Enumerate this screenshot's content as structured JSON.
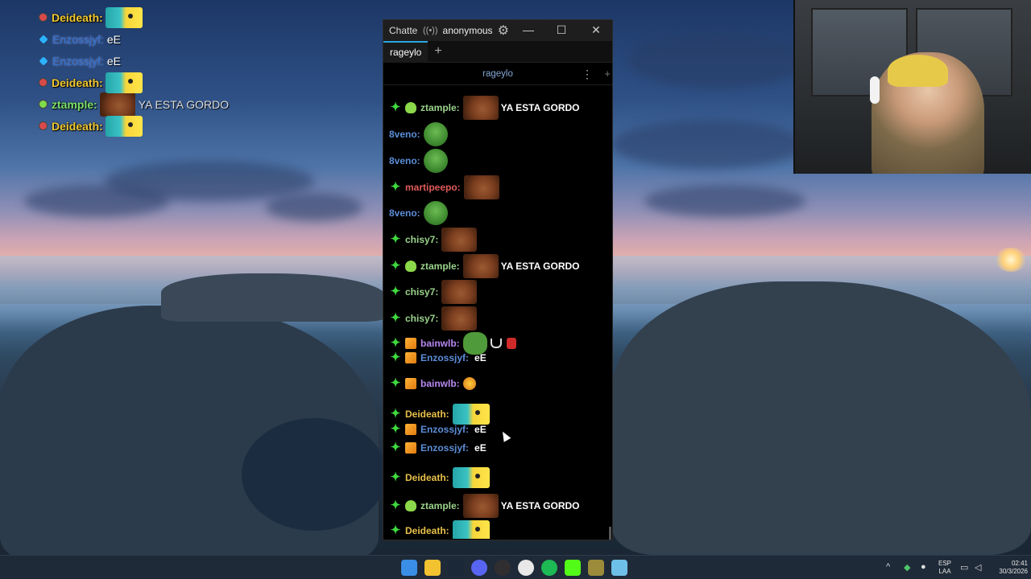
{
  "overlay_chat": [
    {
      "name": "Deideath:",
      "message": "",
      "badge": "mod",
      "emote": "pikachu"
    },
    {
      "name": "Enzossjyf:",
      "message": "eE",
      "badge": "diamond",
      "emote": ""
    },
    {
      "name": "Enzossjyf:",
      "message": "eE",
      "badge": "diamond",
      "emote": ""
    },
    {
      "name": "Deideath:",
      "message": "",
      "badge": "mod",
      "emote": "pikachu"
    },
    {
      "name": "ztample:",
      "message": "YA ESTA GORDO",
      "badge": "alien",
      "emote": "dog"
    },
    {
      "name": "Deideath:",
      "message": "",
      "badge": "mod",
      "emote": "pikachu"
    }
  ],
  "window": {
    "app_name": "Chatterino",
    "stream_icon": "broadcast-icon",
    "user": "anonymous",
    "minimize": "—",
    "maximize": "☐",
    "close": "✕"
  },
  "tabs": [
    {
      "label": "rageylo"
    }
  ],
  "tab_add": "+",
  "split": {
    "channel": "rageylo",
    "menu": "⋮",
    "add": "+"
  },
  "messages": [
    {
      "badge": "star",
      "sub": "alien",
      "user": "ztample:",
      "color": "u-green",
      "emote": "dog",
      "text": "YA ESTA GORDO"
    },
    {
      "badge": "",
      "sub": "",
      "user": "8veno:",
      "color": "u-blue",
      "emote": "pepe",
      "text": ""
    },
    {
      "badge": "",
      "sub": "",
      "user": "8veno:",
      "color": "u-blue",
      "emote": "pepe",
      "text": ""
    },
    {
      "badge": "star",
      "sub": "",
      "user": "martipeepo:",
      "color": "u-red",
      "emote": "dog",
      "text": ""
    },
    {
      "badge": "",
      "sub": "",
      "user": "8veno:",
      "color": "u-blue",
      "emote": "pepe",
      "text": ""
    },
    {
      "badge": "star",
      "sub": "",
      "user": "chisy7:",
      "color": "u-green",
      "emote": "dog",
      "text": ""
    },
    {
      "badge": "star",
      "sub": "alien",
      "user": "ztample:",
      "color": "u-green",
      "emote": "dog",
      "text": "YA ESTA GORDO"
    },
    {
      "badge": "star",
      "sub": "",
      "user": "chisy7:",
      "color": "u-green",
      "emote": "dog",
      "text": ""
    },
    {
      "badge": "star",
      "sub": "",
      "user": "chisy7:",
      "color": "u-green",
      "emote": "dog",
      "text": ""
    },
    {
      "badge": "star",
      "sub": "cube",
      "user": "bainwlb:",
      "color": "u-purp",
      "emote": "frog2",
      "text": ""
    },
    {
      "badge": "star",
      "sub": "cube",
      "user": "Enzossjyf:",
      "color": "u-blue",
      "emote": "",
      "text": "eE"
    },
    {
      "badge": "star",
      "sub": "cube",
      "user": "bainwlb:",
      "color": "u-purp",
      "emote": "sun",
      "text": ""
    },
    {
      "badge": "star",
      "sub": "",
      "user": "Deideath:",
      "color": "u-gold",
      "emote": "pikachu",
      "text": ""
    },
    {
      "badge": "star",
      "sub": "cube",
      "user": "Enzossjyf:",
      "color": "u-blue",
      "emote": "",
      "text": "eE"
    },
    {
      "badge": "star",
      "sub": "cube",
      "user": "Enzossjyf:",
      "color": "u-blue",
      "emote": "",
      "text": "eE"
    },
    {
      "badge": "star",
      "sub": "",
      "user": "Deideath:",
      "color": "u-gold",
      "emote": "pikachu",
      "text": ""
    },
    {
      "badge": "star",
      "sub": "alien",
      "user": "ztample:",
      "color": "u-green",
      "emote": "dog",
      "text": "YA ESTA GORDO"
    },
    {
      "badge": "star",
      "sub": "",
      "user": "Deideath:",
      "color": "u-gold",
      "emote": "pikachu",
      "text": ""
    }
  ],
  "taskbar": {
    "apps": [
      "windows-start-icon",
      "file-explorer-icon",
      "steam-icon",
      "discord-icon",
      "obs-icon",
      "chrome-icon",
      "spotify-icon",
      "kick-icon",
      "game-icon",
      "chatterino-icon"
    ],
    "lang_top": "ESP",
    "lang_bottom": "LAA",
    "time": "02:41",
    "date": "30/3/2026"
  },
  "colors": {
    "accent": "#2aa7e0",
    "green_star": "#3ed93e"
  }
}
